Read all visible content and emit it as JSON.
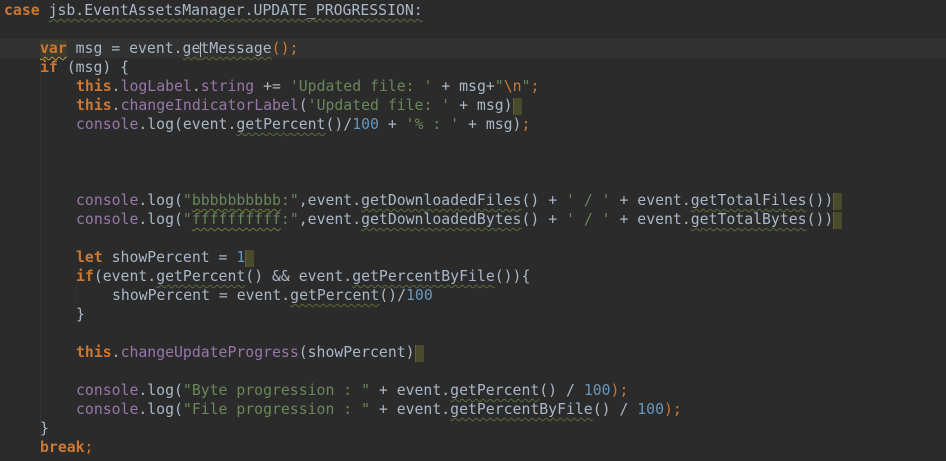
{
  "lines": [
    {
      "indent": 0,
      "tokens": [
        {
          "t": "case",
          "c": "kw"
        },
        {
          "t": " "
        },
        {
          "t": "jsb.EventAssetsManager.UPDATE_PROGRESSION:",
          "c": "plain squig"
        }
      ]
    },
    {
      "indent": 0,
      "tokens": []
    },
    {
      "indent": 1,
      "current": true,
      "tokens": [
        {
          "t": "var",
          "c": "kw kw-var-hl"
        },
        {
          "t": " msg = event."
        },
        {
          "t": "ge",
          "c": "plain squig"
        },
        {
          "caret": true
        },
        {
          "t": "tMessage",
          "c": "plain squig"
        },
        {
          "t": "();",
          "c": "kwn"
        }
      ]
    },
    {
      "indent": 1,
      "tokens": [
        {
          "t": "if",
          "c": "kw"
        },
        {
          "t": " (msg) {"
        }
      ]
    },
    {
      "indent": 2,
      "tokens": [
        {
          "t": "this",
          "c": "kw"
        },
        {
          "t": "."
        },
        {
          "t": "logLabel",
          "c": "prop"
        },
        {
          "t": "."
        },
        {
          "t": "string",
          "c": "prop"
        },
        {
          "t": " += "
        },
        {
          "t": "'Updated file: '",
          "c": "str"
        },
        {
          "t": " + msg+"
        },
        {
          "t": "\"",
          "c": "str"
        },
        {
          "t": "\\n",
          "c": "esc"
        },
        {
          "t": "\"",
          "c": "str"
        },
        {
          "t": ";",
          "c": "kwn"
        }
      ]
    },
    {
      "indent": 2,
      "tokens": [
        {
          "t": "this",
          "c": "kw"
        },
        {
          "t": "."
        },
        {
          "t": "changeIndicatorLabel",
          "c": "prop"
        },
        {
          "t": "("
        },
        {
          "t": "'Updated file: '",
          "c": "str"
        },
        {
          "t": " + msg)"
        },
        {
          "mark": true
        }
      ]
    },
    {
      "indent": 2,
      "tokens": [
        {
          "t": "console",
          "c": "prop"
        },
        {
          "t": ".log(event."
        },
        {
          "t": "getPercent",
          "c": "plain squig"
        },
        {
          "t": "()/"
        },
        {
          "t": "100",
          "c": "num"
        },
        {
          "t": " + "
        },
        {
          "t": "'% : '",
          "c": "str"
        },
        {
          "t": " + msg)"
        },
        {
          "t": ";",
          "c": "kwn"
        }
      ]
    },
    {
      "indent": 0,
      "tokens": []
    },
    {
      "indent": 0,
      "tokens": []
    },
    {
      "indent": 0,
      "tokens": []
    },
    {
      "indent": 2,
      "tokens": [
        {
          "t": "console",
          "c": "prop"
        },
        {
          "t": ".log("
        },
        {
          "t": "\"",
          "c": "str"
        },
        {
          "t": "bbbbbbbbbb",
          "c": "str squig-green"
        },
        {
          "t": ":\"",
          "c": "str"
        },
        {
          "t": ",event."
        },
        {
          "t": "getDownloadedFiles",
          "c": "plain squig"
        },
        {
          "t": "() + "
        },
        {
          "t": "' / '",
          "c": "str"
        },
        {
          "t": " + event."
        },
        {
          "t": "getTotalFiles",
          "c": "plain squig"
        },
        {
          "t": "())"
        },
        {
          "mark": true
        }
      ]
    },
    {
      "indent": 2,
      "tokens": [
        {
          "t": "console",
          "c": "prop"
        },
        {
          "t": ".log("
        },
        {
          "t": "\"",
          "c": "str"
        },
        {
          "t": "ffffffffff",
          "c": "str squig-green"
        },
        {
          "t": ":\"",
          "c": "str"
        },
        {
          "t": ",event."
        },
        {
          "t": "getDownloadedBytes",
          "c": "plain squig"
        },
        {
          "t": "() + "
        },
        {
          "t": "' / '",
          "c": "str"
        },
        {
          "t": " + event."
        },
        {
          "t": "getTotalBytes",
          "c": "plain squig"
        },
        {
          "t": "())"
        },
        {
          "mark": true
        }
      ]
    },
    {
      "indent": 0,
      "tokens": []
    },
    {
      "indent": 2,
      "tokens": [
        {
          "t": "let",
          "c": "kw"
        },
        {
          "t": " showPercent = "
        },
        {
          "t": "1",
          "c": "num"
        },
        {
          "mark": true
        }
      ]
    },
    {
      "indent": 2,
      "tokens": [
        {
          "t": "if",
          "c": "kw"
        },
        {
          "t": "(event."
        },
        {
          "t": "getPercent",
          "c": "plain squig"
        },
        {
          "t": "() && event."
        },
        {
          "t": "getPercentByFile",
          "c": "plain squig"
        },
        {
          "t": "()){"
        }
      ]
    },
    {
      "indent": 3,
      "tokens": [
        {
          "t": "showPercent = event."
        },
        {
          "t": "getPercent",
          "c": "plain squig"
        },
        {
          "t": "()/"
        },
        {
          "t": "100",
          "c": "num"
        }
      ]
    },
    {
      "indent": 2,
      "tokens": [
        {
          "t": "}"
        }
      ]
    },
    {
      "indent": 0,
      "tokens": []
    },
    {
      "indent": 2,
      "tokens": [
        {
          "t": "this",
          "c": "kw"
        },
        {
          "t": "."
        },
        {
          "t": "changeUpdateProgress",
          "c": "prop"
        },
        {
          "t": "(showPercent)"
        },
        {
          "mark": true
        }
      ]
    },
    {
      "indent": 0,
      "tokens": []
    },
    {
      "indent": 2,
      "tokens": [
        {
          "t": "console",
          "c": "prop"
        },
        {
          "t": ".log("
        },
        {
          "t": "\"Byte progression : \"",
          "c": "str"
        },
        {
          "t": " + event."
        },
        {
          "t": "getPercent",
          "c": "plain squig"
        },
        {
          "t": "() / "
        },
        {
          "t": "100",
          "c": "num"
        },
        {
          "t": ");",
          "c": "kwn"
        }
      ]
    },
    {
      "indent": 2,
      "tokens": [
        {
          "t": "console",
          "c": "prop"
        },
        {
          "t": ".log("
        },
        {
          "t": "\"File progression : \"",
          "c": "str"
        },
        {
          "t": " + event."
        },
        {
          "t": "getPercentByFile",
          "c": "plain squig"
        },
        {
          "t": "() / "
        },
        {
          "t": "100",
          "c": "num"
        },
        {
          "t": ");",
          "c": "kwn"
        }
      ]
    },
    {
      "indent": 1,
      "tokens": [
        {
          "t": "}"
        }
      ]
    },
    {
      "indent": 1,
      "tokens": [
        {
          "t": "break",
          "c": "kw"
        },
        {
          "t": ";",
          "c": "kwn"
        }
      ]
    },
    {
      "indent": 0,
      "tokens": []
    }
  ]
}
